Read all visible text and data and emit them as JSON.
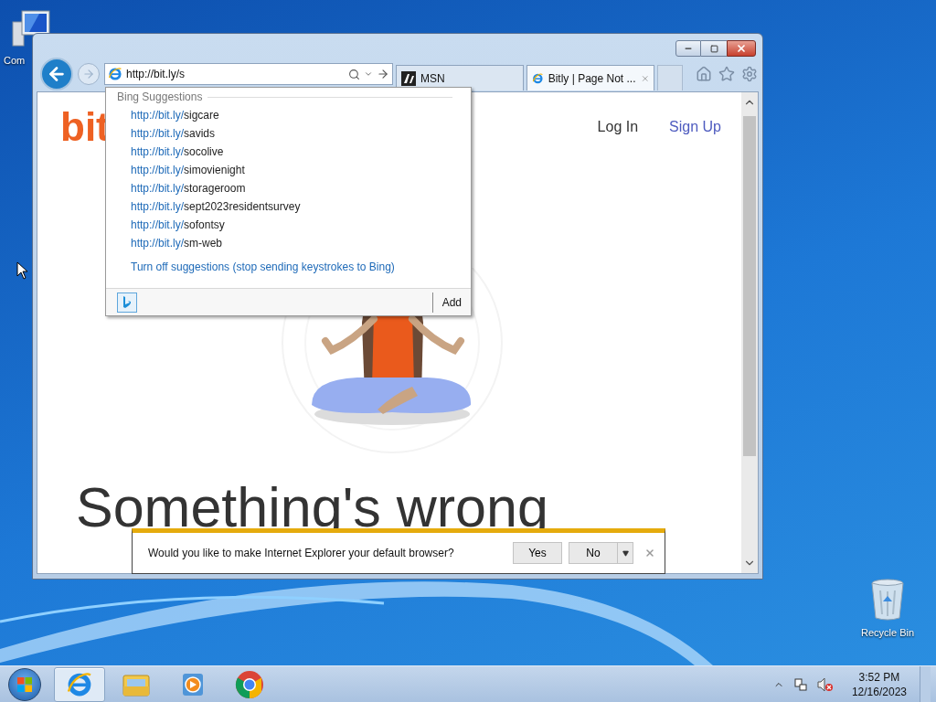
{
  "desktop_icons": [
    {
      "label": "Com",
      "kind": "computer"
    },
    {
      "label": "Recycle Bin",
      "kind": "recycle"
    }
  ],
  "browser": {
    "address": "http://bit.ly/s",
    "tabs": [
      {
        "label": "MSN",
        "kind": "msn",
        "selected": false
      },
      {
        "label": "Bitly | Page Not ...",
        "kind": "ie",
        "selected": true
      }
    ],
    "page": {
      "logo": "bit",
      "nav": [
        {
          "label": "Log In",
          "kind": "plain"
        },
        {
          "label": "Sign Up",
          "kind": "link"
        }
      ],
      "heading": "Something's wrong"
    },
    "suggestions": {
      "header": "Bing Suggestions",
      "items": [
        {
          "prefix": "http://bit.ly/",
          "rest": "sigcare"
        },
        {
          "prefix": "http://bit.ly/",
          "rest": "savids"
        },
        {
          "prefix": "http://bit.ly/",
          "rest": "socolive"
        },
        {
          "prefix": "http://bit.ly/",
          "rest": "simovienight"
        },
        {
          "prefix": "http://bit.ly/",
          "rest": "storageroom"
        },
        {
          "prefix": "http://bit.ly/",
          "rest": "sept2023residentsurvey"
        },
        {
          "prefix": "http://bit.ly/",
          "rest": "sofontsy"
        },
        {
          "prefix": "http://bit.ly/",
          "rest": "sm-web"
        }
      ],
      "turn_off": "Turn off suggestions (stop sending keystrokes to Bing)",
      "add": "Add"
    },
    "notification": {
      "message": "Would you like to make Internet Explorer your default browser?",
      "buttons": [
        "Yes",
        "No"
      ]
    }
  },
  "taskbar": {
    "apps": [
      {
        "kind": "ie",
        "selected": true
      },
      {
        "kind": "explorer",
        "selected": false
      },
      {
        "kind": "media",
        "selected": false
      },
      {
        "kind": "chrome",
        "selected": false
      }
    ],
    "time": "3:52 PM",
    "date": "12/16/2023"
  }
}
